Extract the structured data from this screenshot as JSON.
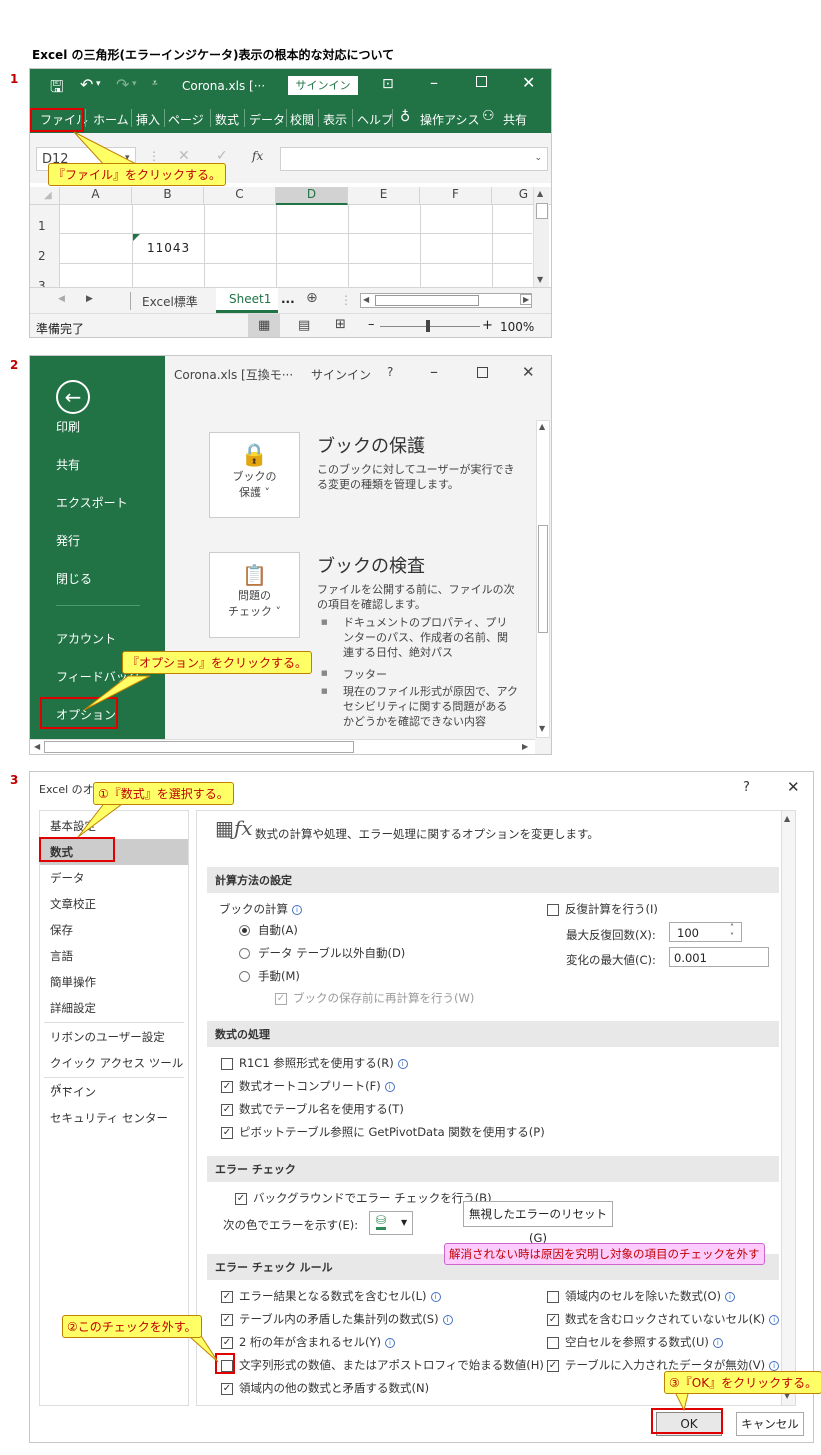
{
  "doc_title": "Excel の三角形(エラーインジケータ)表示の根本的な対応について",
  "steps": [
    "1",
    "2",
    "3"
  ],
  "win1": {
    "filename": "Corona.xls  [···",
    "signin": "サインイン",
    "tabs": [
      "ファイル",
      "ホーム",
      "挿入",
      "ページ",
      "数式",
      "データ",
      "校閲",
      "表示",
      "ヘルプ"
    ],
    "tell_me": "操作アシス",
    "share": "共有",
    "namebox": "D12",
    "fx": "fx",
    "columns": [
      "A",
      "B",
      "C",
      "D",
      "E",
      "F",
      "G"
    ],
    "rows": [
      "1",
      "2",
      "3"
    ],
    "cell_b2": "11043",
    "sheets": [
      "Excel標準",
      "Sheet1"
    ],
    "sheet_more": "...",
    "status": "準備完了",
    "zoom": "100%",
    "callout": "『ファイル』をクリックする。"
  },
  "win2": {
    "title": "Corona.xls  [互換モ···",
    "signin": "サインイン",
    "help": "?",
    "nav": [
      "印刷",
      "共有",
      "エクスポート",
      "発行",
      "閉じる",
      "アカウント",
      "フィードバック",
      "オプション"
    ],
    "protect_btn": [
      "ブックの",
      "保護 ˅"
    ],
    "protect_title": "ブックの保護",
    "protect_desc": "このブックに対してユーザーが実行できる変更の種類を管理します。",
    "inspect_btn": [
      "問題の",
      "チェック ˅"
    ],
    "inspect_title": "ブックの検査",
    "inspect_desc": "ファイルを公開する前に、ファイルの次の項目を確認します。",
    "inspect_items": [
      "ドキュメントのプロパティ、プリンターのパス、作成者の名前、関連する日付、絶対パス",
      "フッター",
      "現在のファイル形式が原因で、アクセシビリティに関する問題があるかどうかを確認できない内容"
    ],
    "callout": "『オプション』をクリックする。"
  },
  "win3": {
    "title": "Excel のオプション",
    "help": "?",
    "close": "✕",
    "nav": [
      "基本設定",
      "数式",
      "データ",
      "文章校正",
      "保存",
      "言語",
      "簡単操作",
      "詳細設定",
      "リボンのユーザー設定",
      "クイック アクセス ツール バー",
      "アドイン",
      "セキュリティ センター"
    ],
    "header": "数式の計算や処理、エラー処理に関するオプションを変更します。",
    "sec_calc": "計算方法の設定",
    "book_calc": "ブックの計算",
    "calc_opts": [
      "自動(A)",
      "データ テーブル以外自動(D)",
      "手動(M)"
    ],
    "recalc_save": "ブックの保存前に再計算を行う(W)",
    "iter": "反復計算を行う(I)",
    "max_iter_label": "最大反復回数(X):",
    "max_iter": "100",
    "max_change_label": "変化の最大値(C):",
    "max_change": "0.001",
    "sec_formula": "数式の処理",
    "formula_opts": [
      "R1C1 参照形式を使用する(R)",
      "数式オートコンプリート(F)",
      "数式でテーブル名を使用する(T)",
      "ピボットテーブル参照に GetPivotData 関数を使用する(P)"
    ],
    "formula_checked": [
      false,
      true,
      true,
      true
    ],
    "sec_error": "エラー チェック",
    "bg_check": "バックグラウンドでエラー チェックを行う(B)",
    "color_label": "次の色でエラーを示す(E):",
    "reset_btn": "無視したエラーのリセット(G)",
    "sec_rules": "エラー チェック ルール",
    "rules_left": [
      "エラー結果となる数式を含むセル(L)",
      "テーブル内の矛盾した集計列の数式(S)",
      "2 桁の年が含まれるセル(Y)",
      "文字列形式の数値、またはアポストロフィで始まる数値(H)",
      "領域内の他の数式と矛盾する数式(N)"
    ],
    "rules_left_checked": [
      true,
      true,
      true,
      false,
      true
    ],
    "rules_right": [
      "領域内のセルを除いた数式(O)",
      "数式を含むロックされていないセル(K)",
      "空白セルを参照する数式(U)",
      "テーブルに入力されたデータが無効(V)"
    ],
    "rules_right_checked": [
      false,
      true,
      false,
      true
    ],
    "ok": "OK",
    "cancel": "キャンセル",
    "callout1": "①『数式』を選択する。",
    "callout2": "②このチェックを外す。",
    "callout3": "③『OK』をクリックする。",
    "note": "解消されない時は原因を究明し対象の項目のチェックを外す"
  }
}
